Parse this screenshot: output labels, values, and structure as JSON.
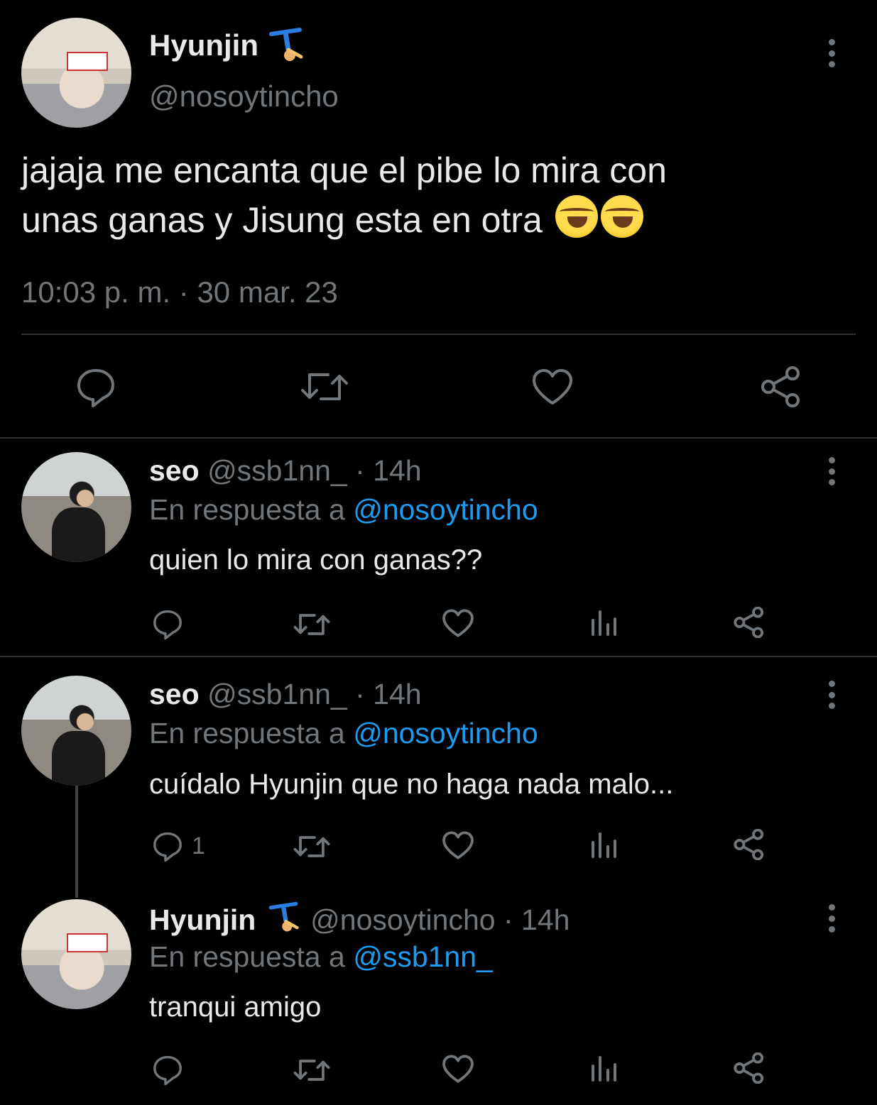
{
  "main_tweet": {
    "author_name": "Hyunjin",
    "author_handle": "@nosoytincho",
    "text_line1": "jajaja me encanta que el pibe lo mira con",
    "text_line2": "unas ganas y Jisung esta en otra",
    "emoji": "rolling-on-floor-laughing",
    "timestamp": "10:03 p. m. · 30 mar. 23",
    "actions": [
      "reply-icon",
      "retweet-icon",
      "like-icon",
      "share-icon"
    ]
  },
  "replies": [
    {
      "author_name": "seo",
      "author_handle": "@ssb1nn_",
      "time": "· 14h",
      "reply_prefix": "En respuesta a",
      "reply_to": "@nosoytincho",
      "text": "quien lo mira con ganas??",
      "reply_count": ""
    },
    {
      "author_name": "seo",
      "author_handle": "@ssb1nn_",
      "time": "· 14h",
      "reply_prefix": "En respuesta a",
      "reply_to": "@nosoytincho",
      "text": "cuídalo Hyunjin que no haga nada malo...",
      "reply_count": "1"
    },
    {
      "author_name": "Hyunjin",
      "author_handle": "@nosoytincho",
      "time": "· 14h",
      "reply_prefix": "En respuesta a",
      "reply_to": "@ssb1nn_",
      "text": "tranqui amigo",
      "reply_count": ""
    }
  ],
  "colors": {
    "background": "#000000",
    "text": "#e7e9ea",
    "muted": "#71767b",
    "link": "#1d9bf0",
    "divider": "#2f3336"
  }
}
